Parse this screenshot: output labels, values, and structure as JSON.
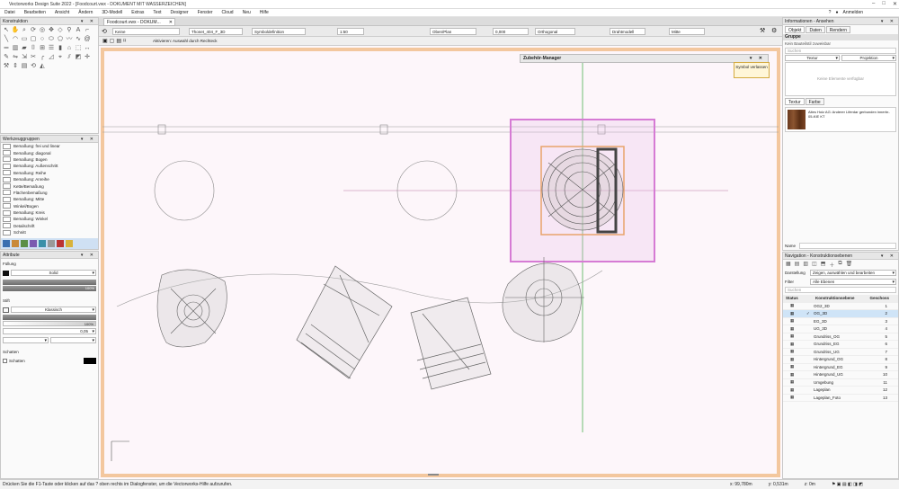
{
  "window": {
    "title": "Vectorworks Design Suite 2022 - [Foodcourt.vwx - DOKUMENT MIT WASSERZEICHEN]",
    "controls": [
      "–",
      "□",
      "✕"
    ]
  },
  "menu": [
    "Datei",
    "Bearbeiten",
    "Ansicht",
    "Ändern",
    "3D-Modell",
    "Extras",
    "Text",
    "Designer",
    "Fenster",
    "Cloud",
    "Neu",
    "Hilfe"
  ],
  "account": {
    "label": "Anmelden"
  },
  "doc_tab": {
    "label": "Foodcourt.vwx - DOKUM...",
    "close": "✕"
  },
  "ribbon": {
    "class_field": "Keine",
    "layer_field": "Thonet_404_F_3D",
    "symbol_field": "Symboldefinition",
    "scale_field": "1:50",
    "view_field": "Oben/Plan",
    "projection_field": "Orthogonal",
    "zoom_field": "0,000",
    "render_field": "Drahtmodell",
    "edit_field": "Mitte",
    "mode_hint": "Aktivieren: Auswahl durch Rechteck"
  },
  "panels": {
    "construction": {
      "title": "Konstruktion"
    },
    "toolsets": {
      "title": "Werkzeuggruppen",
      "items": [
        "Bemaßung: frei und linear",
        "Bemaßung: diagonal",
        "Bemaßung: Bogen",
        "Bemaßung: Außenschritt",
        "Bemaßung: Reihe",
        "Bemaßung: Anreihe",
        "Kette/Bemaßung",
        "Flächenbemaßung",
        "Bemaßung: Mitte",
        "Winkel/Bogen",
        "Bemaßung: Kreis",
        "Bemaßung: Winkel",
        "Detailschrift",
        "Schnitt"
      ]
    },
    "attributes": {
      "title": "Attribute",
      "fill_label": "Füllung",
      "fill_value": "Solid",
      "pen_label": "Stift",
      "pen_value": "Klassisch",
      "opacity1": "100%",
      "opacity2": "100%",
      "line_width": "0,05",
      "shadow_label": "Schatten",
      "shadow_check": "Schatten"
    }
  },
  "info": {
    "title": "Informationen - Ansehen",
    "tabs": [
      "Objekt",
      "Daten",
      "Rendern"
    ],
    "group_label": "Gruppe",
    "subtitle": "Kein Bauteilstil zuweisbar",
    "search_placeholder": "Suchen",
    "col1": "Textur",
    "col2": "Projektion",
    "empty_note": "Keine Elemente verfügbar",
    "texture_tab1": "Textur",
    "texture_tab2": "Farbe",
    "texture_desc": "Altes Holz AG: Anderer Liferdar gerbunden innerbr-05-KIE KT",
    "name_label": "Name"
  },
  "navigation": {
    "title": "Navigation - Konstruktionsebenen",
    "display_label": "Darstellung",
    "display_value": "Zeigen, auswählen und bearbeiten",
    "filter_label": "Filter",
    "filter_value": "Alle Ebenen",
    "search_placeholder": "Suchen",
    "headers": [
      "Status",
      "Konstruktionsebene",
      "Geschoss"
    ],
    "rows": [
      {
        "name": "OG2_3D",
        "n": "1",
        "check": ""
      },
      {
        "name": "OG_3D",
        "n": "2",
        "check": "✓"
      },
      {
        "name": "EG_3D",
        "n": "3",
        "check": ""
      },
      {
        "name": "UG_3D",
        "n": "4",
        "check": ""
      },
      {
        "name": "Grundriss_OG",
        "n": "5",
        "check": ""
      },
      {
        "name": "Grundriss_EG",
        "n": "6",
        "check": ""
      },
      {
        "name": "Grundriss_UG",
        "n": "7",
        "check": ""
      },
      {
        "name": "Hintergrund_OG",
        "n": "8",
        "check": ""
      },
      {
        "name": "Hintergrund_EG",
        "n": "9",
        "check": ""
      },
      {
        "name": "Hintergrund_UG",
        "n": "10",
        "check": ""
      },
      {
        "name": "Umgebung",
        "n": "11",
        "check": ""
      },
      {
        "name": "Lageplan",
        "n": "12",
        "check": ""
      },
      {
        "name": "Lageplan_Foto",
        "n": "13",
        "check": ""
      }
    ]
  },
  "zubehoer": {
    "title": "Zubehör-Manager",
    "button": "Symbol verlassen"
  },
  "status": {
    "hint": "Drücken Sie die F1-Taste oder klicken auf das ? oben rechts im Dialogfenster, um die Vectorworks-Hilfe aufzurufen.",
    "x": "x: 99,780m",
    "y": "y: 0,531m",
    "z": "z: 0m"
  },
  "colors": {
    "selection": "#d67bd4",
    "highlight": "#e8a36b",
    "canvas_border": "#f3c79e",
    "guide_green": "#4caf50"
  }
}
